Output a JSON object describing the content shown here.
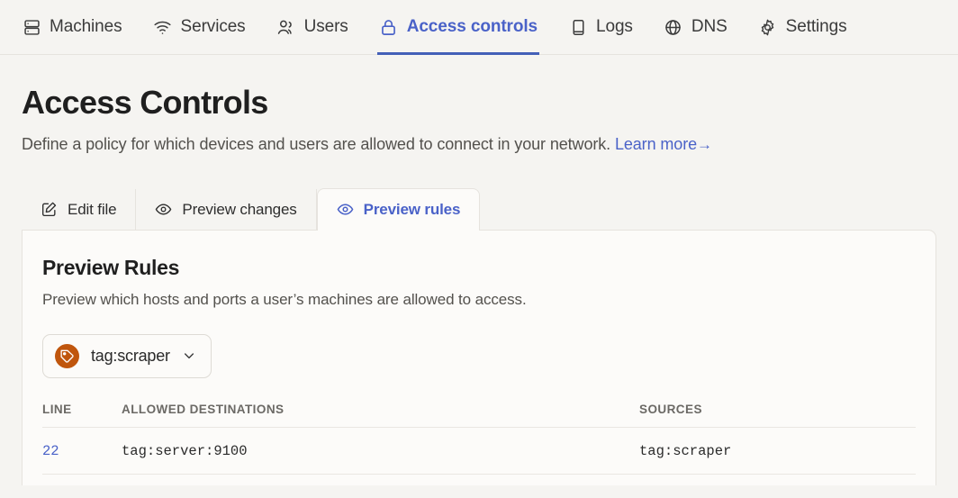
{
  "nav": {
    "items": [
      {
        "label": "Machines",
        "icon": "server-icon",
        "active": false
      },
      {
        "label": "Services",
        "icon": "wifi-icon",
        "active": false
      },
      {
        "label": "Users",
        "icon": "users-icon",
        "active": false
      },
      {
        "label": "Access controls",
        "icon": "lock-icon",
        "active": true
      },
      {
        "label": "Logs",
        "icon": "book-icon",
        "active": false
      },
      {
        "label": "DNS",
        "icon": "globe-icon",
        "active": false
      },
      {
        "label": "Settings",
        "icon": "gear-icon",
        "active": false
      }
    ],
    "active_color": "#4A62C8",
    "underline_color": "#4460B8"
  },
  "page": {
    "title": "Access Controls",
    "description": "Define a policy for which devices and users are allowed to connect in your network.",
    "learn_more_label": "Learn more",
    "learn_more_arrow": "→"
  },
  "tabs": [
    {
      "label": "Edit file",
      "icon": "edit-pencil-icon",
      "active": false
    },
    {
      "label": "Preview changes",
      "icon": "eye-icon",
      "active": false
    },
    {
      "label": "Preview rules",
      "icon": "eye-icon",
      "active": true
    }
  ],
  "card": {
    "title": "Preview Rules",
    "description": "Preview which hosts and ports a user’s machines are allowed to access.",
    "tag_selector": {
      "value": "tag:scraper",
      "badge_icon": "tag-icon",
      "badge_color": "#C0560D",
      "chevron_icon": "chevron-down-icon"
    },
    "table": {
      "columns": [
        "LINE",
        "ALLOWED DESTINATIONS",
        "SOURCES"
      ],
      "rows": [
        {
          "line": "22",
          "destination": "tag:server:9100",
          "source": "tag:scraper"
        }
      ]
    }
  }
}
